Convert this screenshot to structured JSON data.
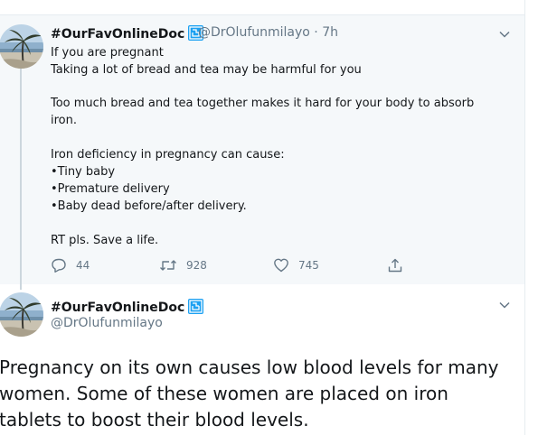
{
  "tweets": [
    {
      "display_name": "#OurFavOnlineDoc",
      "handle_time": "@DrOlufunmilayo · 7h",
      "lines": [
        "If you are pregnant",
        "Taking a lot of bread and tea may be harmful for you",
        "",
        "Too much bread and tea together makes it hard for your body to absorb",
        "iron.",
        "",
        "Iron deficiency in pregnancy can cause:",
        "•Tiny baby",
        "•Premature delivery",
        "•Baby dead before/after delivery.",
        "",
        "RT pls. Save a life."
      ],
      "actions": {
        "replies": "44",
        "retweets": "928",
        "likes": "745"
      }
    },
    {
      "display_name": "#OurFavOnlineDoc",
      "handle": "@DrOlufunmilayo",
      "lines": [
        "Pregnancy on its own causes low blood levels for many",
        "women. Some of these women are placed on iron",
        "tablets to boost their blood levels."
      ]
    }
  ],
  "icons": {
    "avatar": "palm-tree-beach-photo",
    "badge": "verified-app-badge",
    "menu": "chevron-down-icon",
    "reply": "reply-icon",
    "retweet": "retweet-icon",
    "like": "heart-icon",
    "share": "share-icon"
  },
  "colors": {
    "background": "#ffffff",
    "highlight_background": "#f5f8fa",
    "text": "#14171a",
    "secondary_text": "#657786",
    "thread_line": "#ccd6dd",
    "badge": "#1da1f2"
  }
}
